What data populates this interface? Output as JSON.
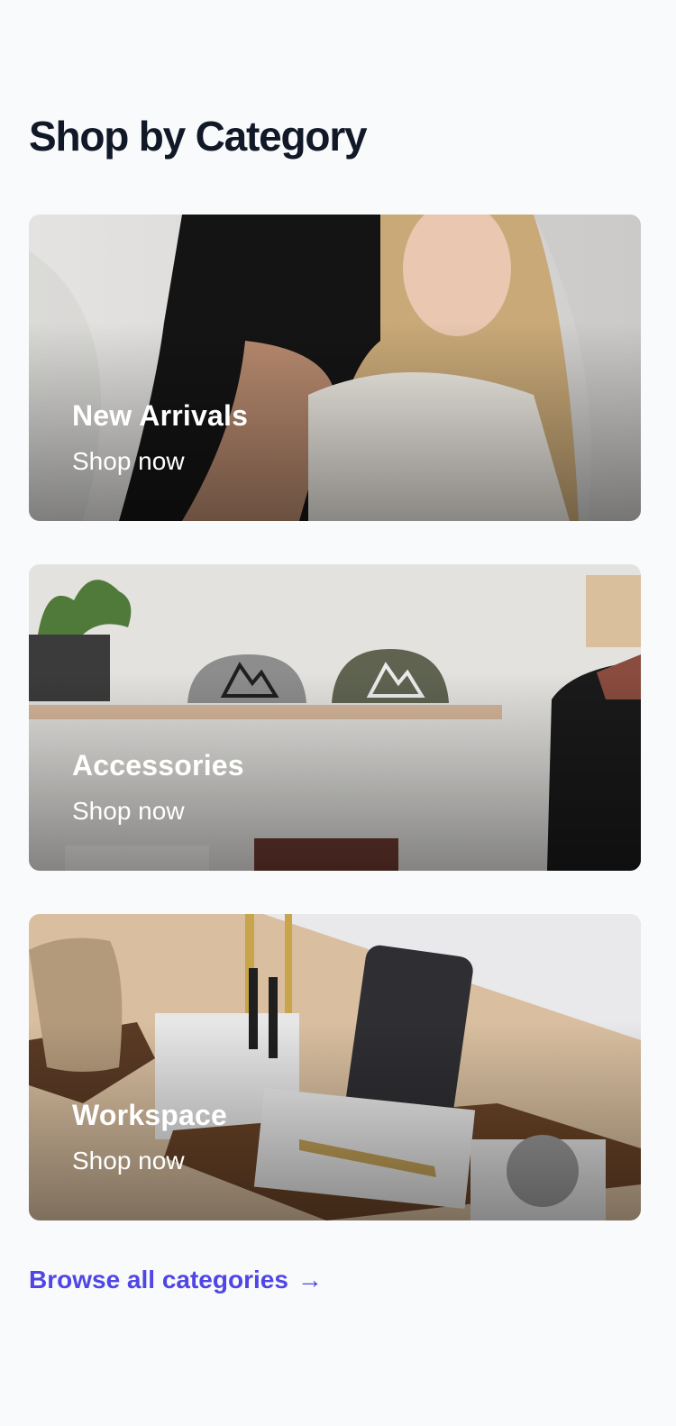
{
  "section": {
    "title": "Shop by Category"
  },
  "categories": [
    {
      "name": "New Arrivals",
      "cta": "Shop now"
    },
    {
      "name": "Accessories",
      "cta": "Shop now"
    },
    {
      "name": "Workspace",
      "cta": "Shop now"
    }
  ],
  "footer_link": {
    "label": "Browse all categories",
    "icon": "arrow-right-icon",
    "glyph": "→"
  },
  "colors": {
    "link": "#4f46e5",
    "title": "#111827",
    "background": "#f9fafb"
  }
}
